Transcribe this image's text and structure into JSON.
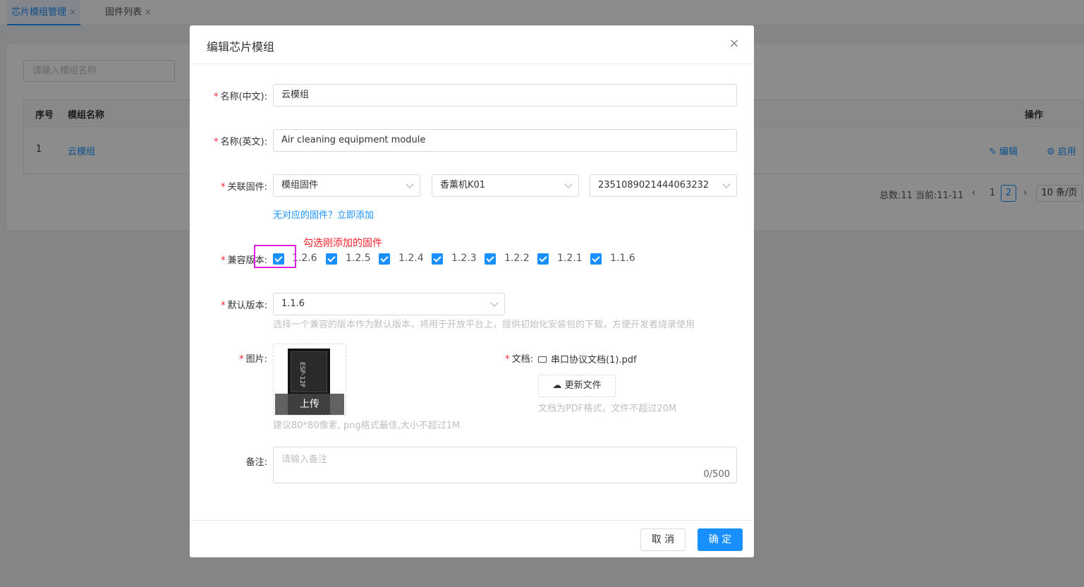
{
  "tabs": [
    {
      "label": "芯片模组管理",
      "close": "×"
    },
    {
      "label": "固件列表",
      "close": "×"
    }
  ],
  "background": {
    "search_placeholder": "请输入模组名称",
    "columns": [
      "序号",
      "模组名称",
      "操作"
    ],
    "row": {
      "index": "1",
      "name": "云模组",
      "edit": "编辑",
      "enable": "启用"
    },
    "pagination": {
      "summary": "总数:11 当前:11-11",
      "pages": [
        "1",
        "2"
      ],
      "current_page": "2",
      "size": "10 条/页",
      "prev": "‹",
      "next": "›"
    }
  },
  "modal": {
    "title": "编辑芯片模组",
    "close": "×",
    "fields": {
      "name_cn": {
        "label": "名称(中文):",
        "value": "云模组"
      },
      "name_en": {
        "label": "名称(英文):",
        "value": "Air cleaning equipment module"
      },
      "firmware": {
        "label": "关联固件:",
        "select1": "模组固件",
        "select2": "香薰机K01",
        "select3": "2351089021444063232",
        "add_link": "无对应的固件？立即添加"
      },
      "versions": {
        "label": "兼容版本:",
        "items": [
          "1.2.6",
          "1.2.5",
          "1.2.4",
          "1.2.3",
          "1.2.2",
          "1.2.1",
          "1.1.6"
        ],
        "annotation": "勾选刚添加的固件"
      },
      "default_version": {
        "label": "默认版本:",
        "value": "1.1.6",
        "hint": "选择一个兼容的版本作为默认版本，将用于开放平台上，提供初始化安装包的下载，方便开发者烧录使用"
      },
      "image": {
        "label": "图片:",
        "upload_label": "上传",
        "hint": "建议80*80像素, png格式最佳,大小不超过1M",
        "chip_text": "ESP-12F"
      },
      "document": {
        "label": "文档:",
        "file_name": "串口协议文档(1).pdf",
        "update_button": "更新文件",
        "hint": "文档为PDF格式，文件不超过20M"
      },
      "remark": {
        "label": "备注:",
        "placeholder": "请输入备注",
        "counter": "0/500"
      }
    },
    "buttons": {
      "cancel": "取 消",
      "ok": "确 定"
    }
  },
  "colors": {
    "primary": "#1890ff",
    "required": "#f5222d",
    "highlight": "#e020e0",
    "annotation": "#f5222d"
  }
}
